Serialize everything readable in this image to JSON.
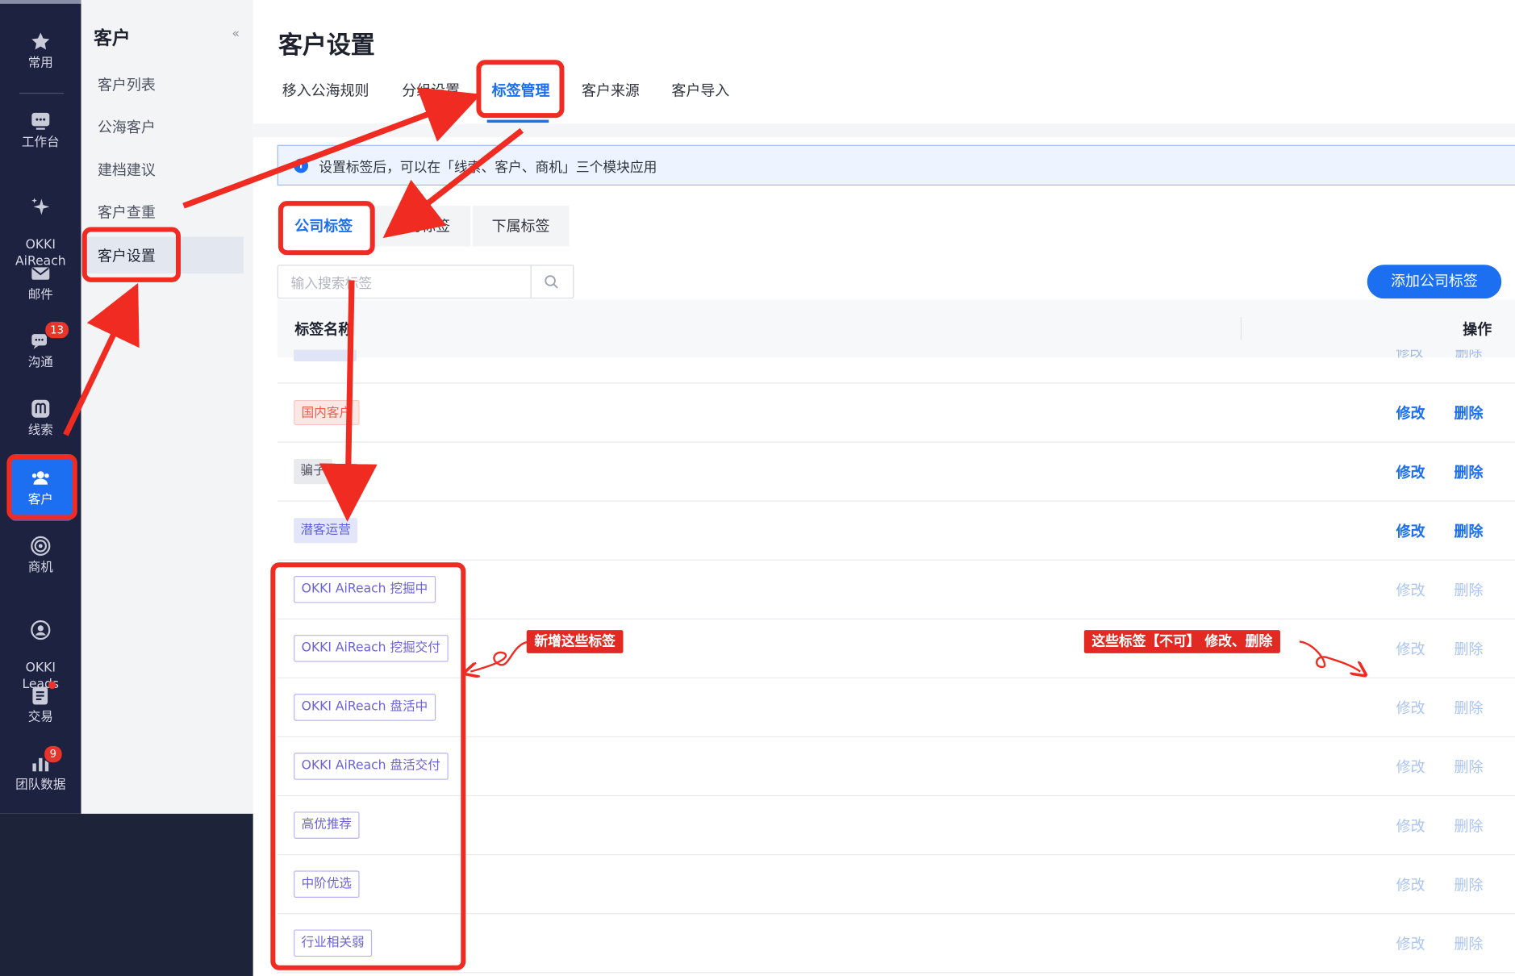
{
  "rail": {
    "items": [
      {
        "key": "favorites",
        "label": "常用",
        "icon": "star-icon"
      },
      {
        "key": "workbench",
        "label": "工作台",
        "icon": "chat-box-icon"
      },
      {
        "key": "aireach",
        "label": "OKKI\nAiReach",
        "icon": "sparkle-icon"
      },
      {
        "key": "mail",
        "label": "邮件",
        "icon": "mail-icon"
      },
      {
        "key": "communication",
        "label": "沟通",
        "icon": "message-icon",
        "badge": "13"
      },
      {
        "key": "leads",
        "label": "线索",
        "icon": "leads-icon"
      },
      {
        "key": "customer",
        "label": "客户",
        "icon": "customer-icon",
        "active": true
      },
      {
        "key": "opportunity",
        "label": "商机",
        "icon": "target-icon"
      },
      {
        "key": "okki_leads",
        "label": "OKKI\nLeads",
        "icon": "person-search-icon"
      },
      {
        "key": "deal",
        "label": "交易",
        "icon": "document-icon",
        "dot": true
      },
      {
        "key": "team_data",
        "label": "团队数据",
        "icon": "bar-chart-icon",
        "badge": "9"
      }
    ]
  },
  "subnav": {
    "title": "客户",
    "collapse": "«",
    "items": [
      "客户列表",
      "公海客户",
      "建档建议",
      "客户查重",
      "客户设置"
    ]
  },
  "main": {
    "title": "客户设置",
    "tabs": [
      "移入公海规则",
      "分组设置",
      "标签管理",
      "客户来源",
      "客户导入"
    ],
    "notice": "设置标签后，可以在「线索、客户、商机」三个模块应用",
    "subtabs": [
      "公司标签",
      "我的标签",
      "下属标签"
    ],
    "search_placeholder": "输入搜索标签",
    "add_button": "添加公司标签",
    "table": {
      "col_name": "标签名称",
      "col_action": "操作",
      "partial_edit": "修改",
      "partial_delete": "删除",
      "rows": [
        {
          "tag": "国内客户",
          "style": "red",
          "edit": "修改",
          "delete": "删除",
          "enabled": true
        },
        {
          "tag": "骗子",
          "style": "gray",
          "edit": "修改",
          "delete": "删除",
          "enabled": true
        },
        {
          "tag": "潜客运营",
          "style": "purple",
          "edit": "修改",
          "delete": "删除",
          "enabled": true
        },
        {
          "tag": "OKKI AiReach 挖掘中",
          "style": "outline",
          "edit": "修改",
          "delete": "删除",
          "enabled": false
        },
        {
          "tag": "OKKI AiReach 挖掘交付",
          "style": "outline",
          "edit": "修改",
          "delete": "删除",
          "enabled": false
        },
        {
          "tag": "OKKI AiReach 盘活中",
          "style": "outline",
          "edit": "修改",
          "delete": "删除",
          "enabled": false
        },
        {
          "tag": "OKKI AiReach 盘活交付",
          "style": "outline",
          "edit": "修改",
          "delete": "删除",
          "enabled": false
        },
        {
          "tag": "高优推荐",
          "style": "outline",
          "edit": "修改",
          "delete": "删除",
          "enabled": false
        },
        {
          "tag": "中阶优选",
          "style": "outline",
          "edit": "修改",
          "delete": "删除",
          "enabled": false
        },
        {
          "tag": "行业相关弱",
          "style": "outline",
          "edit": "修改",
          "delete": "删除",
          "enabled": false
        }
      ]
    }
  },
  "annotations": {
    "new_tags": "新增这些标签",
    "cannot_edit": "这些标签【不可】 修改、删除"
  },
  "colors": {
    "rail_bg": "#1d2240",
    "accent": "#1b6ff0",
    "annotation_red": "#ef2b22"
  }
}
